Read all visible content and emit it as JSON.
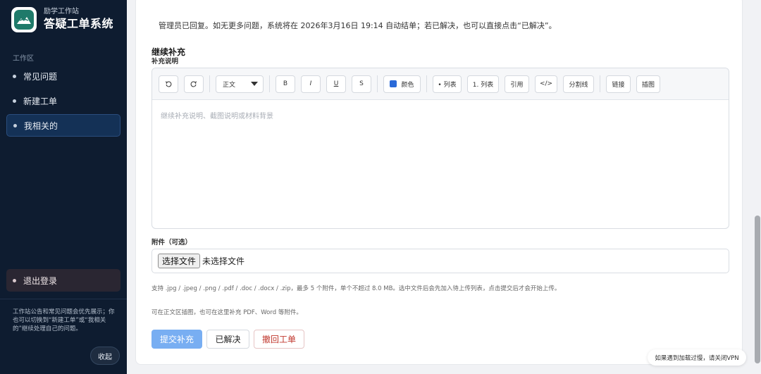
{
  "brand": {
    "subtitle": "励学工作站",
    "title": "答疑工单系统",
    "logo_icon": "book-on-hills-icon",
    "accent": "#1f7a6a"
  },
  "sidebar": {
    "section_label": "工作区",
    "items": [
      {
        "label": "常见问题",
        "active": false
      },
      {
        "label": "新建工单",
        "active": false
      },
      {
        "label": "我相关的",
        "active": true
      }
    ],
    "logout_label": "退出登录",
    "note": "工作站公告和常见问题会优先展示；你也可以切换到“新建工单”或“我相关的”继续处理自己的问题。",
    "collapse_label": "收起"
  },
  "main": {
    "notice": "管理员已回复。如无更多问题，系统将在 2026年3月16日 19:14 自动结单；若已解决，也可以直接点击“已解决”。",
    "section_title": "继续补充",
    "field_label": "补充说明",
    "toolbar": {
      "undo_icon": "undo-icon",
      "redo_icon": "redo-icon",
      "block_format": "正文",
      "bold": "B",
      "italic": "I",
      "underline": "U",
      "strike": "S",
      "color": "颜色",
      "color_value": "#2a6ad8",
      "bullet_list": "• 列表",
      "ordered_list": "1. 列表",
      "quote": "引用",
      "code": "</>",
      "divider": "分割线",
      "link": "链接",
      "image": "插图"
    },
    "editor_placeholder": "继续补充说明、截图说明或材料背景",
    "attachment_label": "附件（可选）",
    "file_button": "选择文件",
    "file_status": "未选择文件",
    "hint_formats": "支持 .jpg / .jpeg / .png / .pdf / .doc / .docx / .zip，最多 5 个附件，单个不超过 8.0 MB。选中文件后会先加入待上传列表，点击提交后才会开始上传。",
    "hint_inline": "可在正文区插图，也可在这里补充 PDF、Word 等附件。",
    "buttons": {
      "submit": "提交补充",
      "resolve": "已解决",
      "withdraw": "撤回工单"
    }
  },
  "toast": "如果遇到加载过慢，请关闭VPN"
}
